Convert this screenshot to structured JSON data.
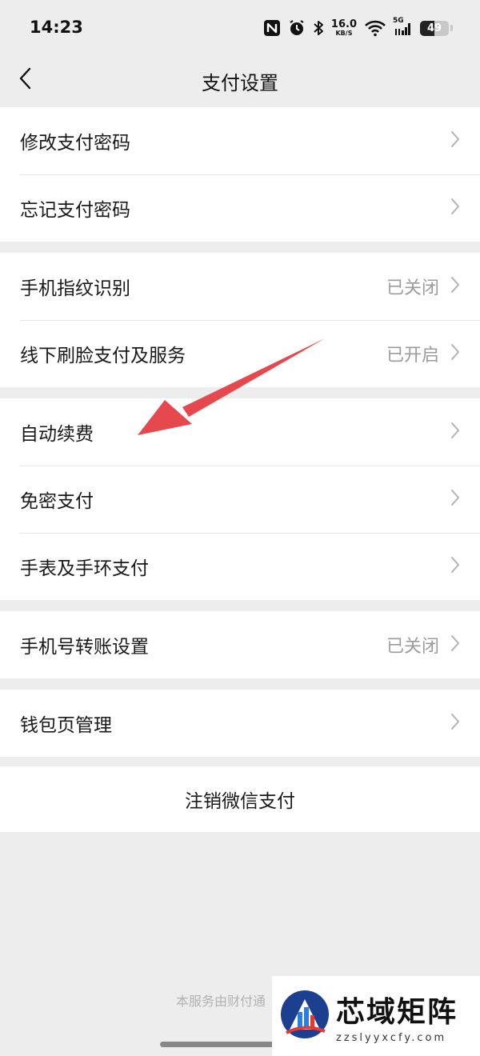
{
  "status_bar": {
    "time": "14:23",
    "speed_value": "16.0",
    "speed_unit": "KB/S",
    "network": "5G",
    "battery": "49",
    "battery_level": 0.49,
    "icons": [
      "nfc-icon",
      "alarm-icon",
      "bluetooth-icon",
      "wifi-icon",
      "signal-icon",
      "battery-icon"
    ]
  },
  "nav": {
    "back_icon": "chevron-left-icon",
    "title": "支付设置"
  },
  "groups": [
    {
      "items": [
        {
          "label": "修改支付密码",
          "value": ""
        },
        {
          "label": "忘记支付密码",
          "value": ""
        }
      ]
    },
    {
      "items": [
        {
          "label": "手机指纹识别",
          "value": "已关闭"
        },
        {
          "label": "线下刷脸支付及服务",
          "value": "已开启"
        }
      ]
    },
    {
      "items": [
        {
          "label": "自动续费",
          "value": ""
        },
        {
          "label": "免密支付",
          "value": ""
        },
        {
          "label": "手表及手环支付",
          "value": ""
        }
      ]
    },
    {
      "items": [
        {
          "label": "手机号转账设置",
          "value": "已关闭"
        }
      ]
    },
    {
      "items": [
        {
          "label": "钱包页管理",
          "value": ""
        }
      ]
    }
  ],
  "deregister_button": "注销微信支付",
  "footer_note": "本服务由财付通",
  "annotation": {
    "type": "arrow",
    "color": "#e5484d",
    "points_to": "自动续费"
  },
  "watermark": {
    "title": "芯域矩阵",
    "url": "zzslyyxcfy.com"
  },
  "colors": {
    "page_bg": "#ededed",
    "card_bg": "#ffffff",
    "text": "#191919",
    "secondary_text": "#9b9b9b",
    "arrow": "#e5484d"
  }
}
